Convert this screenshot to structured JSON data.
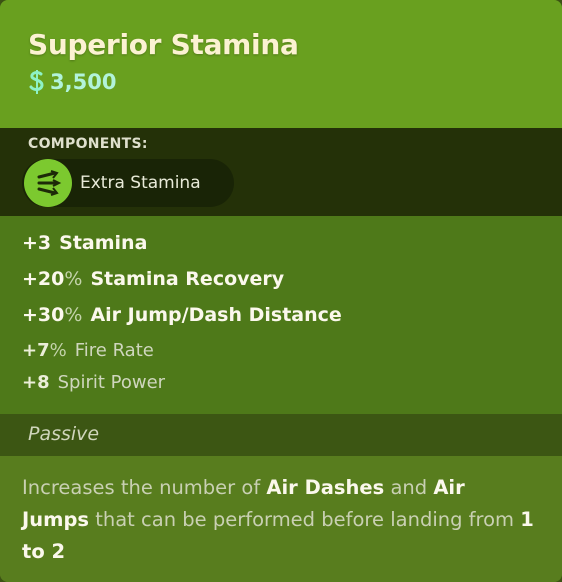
{
  "item": {
    "title": "Superior Stamina",
    "price": "3,500",
    "currency_icon": "souls-currency-icon",
    "components_label": "COMPONENTS:",
    "component": {
      "name": "Extra Stamina",
      "icon": "stamina-arrows-icon"
    },
    "stats": [
      {
        "value": "+3",
        "pct": "",
        "name": "Stamina"
      },
      {
        "value": "+20",
        "pct": "%",
        "name": "Stamina Recovery"
      },
      {
        "value": "+30",
        "pct": "%",
        "name": "Air Jump/Dash Distance"
      },
      {
        "value": "+7",
        "pct": "%",
        "name": "Fire Rate"
      },
      {
        "value": "+8",
        "pct": "",
        "name": "Spirit Power"
      }
    ],
    "passive_label": "Passive",
    "description": {
      "t1": "Increases the number of ",
      "b1": "Air Dashes",
      "t2": " and ",
      "b2": "Air Jumps",
      "t3": " that can be performed before landing from ",
      "b3": "1 to 2"
    }
  },
  "colors": {
    "header_bg": "#69a01f",
    "components_bg": "#243108",
    "stats_bg": "#4e7919",
    "passive_bg": "#3c5613",
    "desc_bg": "#587d1e",
    "title_color": "#fbf2d2",
    "price_color": "#b2f3da"
  }
}
